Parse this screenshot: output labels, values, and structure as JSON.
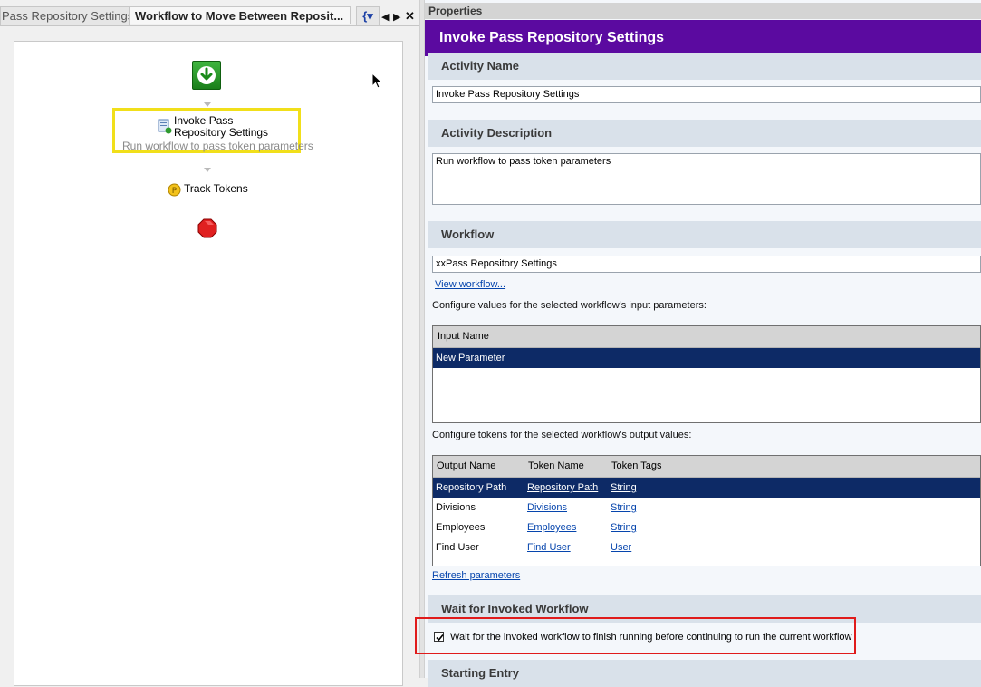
{
  "tabs": {
    "tab1": "Pass Repository Settings",
    "tab2": "Workflow to Move Between Reposit...",
    "tab3": "{▾"
  },
  "designer": {
    "invoke_title": "Invoke Pass Repository Settings",
    "invoke_desc": "Run workflow to pass token parameters",
    "track_label": "Track Tokens"
  },
  "properties": {
    "bar_title": "Properties",
    "header_title": "Invoke Pass Repository Settings",
    "activity_name_label": "Activity Name",
    "activity_name_value": "Invoke Pass Repository Settings",
    "activity_desc_label": "Activity Description",
    "activity_desc_value": "Run workflow to pass token parameters",
    "workflow_label": "Workflow",
    "workflow_value": "xxPass Repository Settings",
    "view_workflow_link": "View workflow...",
    "input_params_text": "Configure values for the selected workflow's input parameters:",
    "input_grid": {
      "header": "Input Name",
      "rows": [
        "New Parameter"
      ]
    },
    "output_tokens_text": "Configure tokens for the selected workflow's output values:",
    "output_grid": {
      "headers": [
        "Output Name",
        "Token Name",
        "Token Tags"
      ],
      "rows": [
        {
          "output": "Repository Path",
          "token": "Repository Path",
          "tags": "String"
        },
        {
          "output": "Divisions",
          "token": "Divisions",
          "tags": "String"
        },
        {
          "output": "Employees",
          "token": "Employees",
          "tags": "String"
        },
        {
          "output": "Find User",
          "token": "Find User",
          "tags": "User"
        }
      ]
    },
    "refresh_link": "Refresh parameters",
    "wait_label": "Wait for Invoked Workflow",
    "wait_checkbox_label": "Wait for the invoked workflow to finish running before continuing to run the current workflow",
    "wait_checked": true,
    "starting_entry_label": "Starting Entry"
  },
  "colors": {
    "header_bg": "#5b0aa0",
    "selected_row_bg": "#0d2a66",
    "highlight_yellow": "#f1df1a",
    "highlight_red": "#e01b1b"
  }
}
